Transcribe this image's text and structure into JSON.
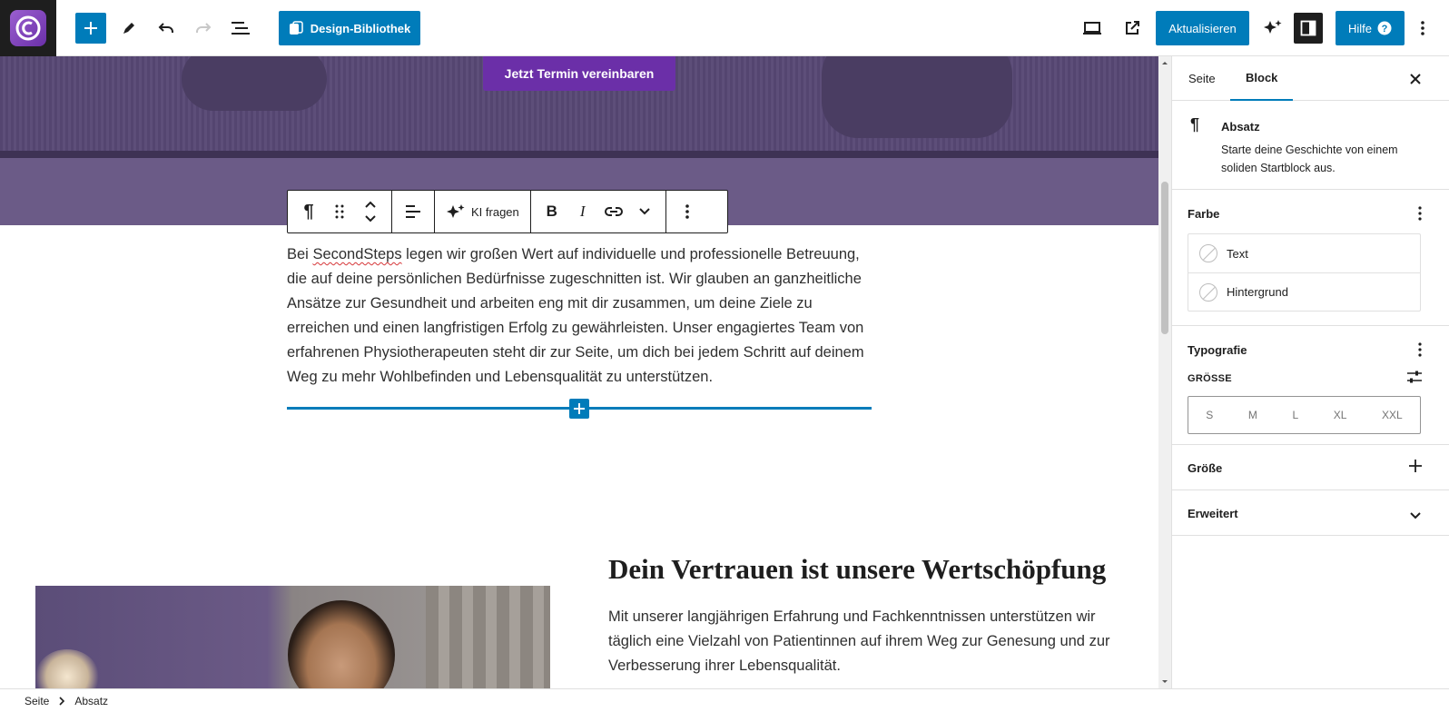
{
  "toolbar": {
    "design_library_label": "Design-Bibliothek",
    "update_label": "Aktualisieren",
    "help_label": "Hilfe"
  },
  "canvas": {
    "cta_label": "Jetzt Termin vereinbaren",
    "block_toolbar": {
      "ai_label": "KI fragen"
    },
    "paragraph": {
      "pre": "Bei ",
      "misspelled": "SecondSteps",
      "post": " legen wir großen Wert auf individuelle und professionelle Betreuung, die auf deine persönlichen Bedürfnisse zugeschnitten ist. Wir glauben an ganzheitliche Ansätze zur Gesundheit und arbeiten eng mit dir zusammen, um deine Ziele zu erreichen und einen langfristigen Erfolg zu gewährleisten. Unser engagiertes Team von erfahrenen Physiotherapeuten steht dir zur Seite, um dich bei jedem Schritt auf deinem Weg zu mehr Wohlbefinden und Lebensqualität zu unterstützen."
    },
    "heading": "Dein Vertrauen ist unsere Wertschöpfung",
    "paragraph2": "Mit unserer langjährigen Erfahrung und Fachkenntnissen unterstützen wir täglich eine Vielzahl von Patientinnen auf ihrem Weg zur Genesung und zur Verbesserung ihrer Lebensqualität."
  },
  "sidebar": {
    "tabs": [
      "Seite",
      "Block"
    ],
    "active_tab": "Block",
    "block": {
      "title": "Absatz",
      "description": "Starte deine Geschichte von einem soliden Startblock aus."
    },
    "color_panel": {
      "title": "Farbe",
      "items": [
        "Text",
        "Hintergrund"
      ]
    },
    "typography_panel": {
      "title": "Typografie",
      "size_label": "GRÖSSE",
      "sizes": [
        "S",
        "M",
        "L",
        "XL",
        "XXL"
      ]
    },
    "size_panel": {
      "title": "Größe"
    },
    "advanced_panel": {
      "title": "Erweitert"
    }
  },
  "breadcrumb": [
    "Seite",
    "Absatz"
  ],
  "colors": {
    "accent": "#007cba",
    "cta": "#6b2fa8",
    "dark": "#1e1e1e"
  }
}
